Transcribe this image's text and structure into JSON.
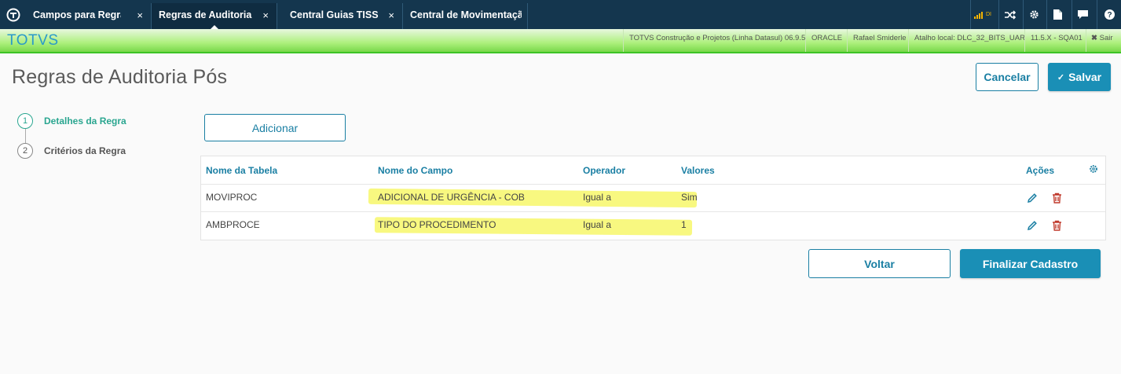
{
  "tabs": [
    {
      "label": "Campos para Regras de",
      "close": "×"
    },
    {
      "label": "Regras de Auditoria e",
      "close": "×"
    },
    {
      "label": "Central Guias TISS",
      "close": "×"
    },
    {
      "label": "Central de Movimentação",
      "close": ""
    }
  ],
  "topbar_icons": [
    "signal-icon",
    "shuffle-icon",
    "gear-icon",
    "document-icon",
    "chat-icon",
    "help-icon"
  ],
  "topbar_signal_text": "DI",
  "brand": "TOTVS",
  "info": {
    "company": "TOTVS Construção e Projetos (Linha Datasul) 06.9.5...",
    "db": "ORACLE",
    "user": "Rafael Smiderle",
    "shortcut": "Atalho local: DLC_32_BITS_UAR",
    "version": "11.5.X - SQA01",
    "exit": "Sair"
  },
  "page": {
    "title": "Regras de Auditoria Pós"
  },
  "buttons": {
    "cancel": "Cancelar",
    "save": "Salvar",
    "add": "Adicionar",
    "back": "Voltar",
    "finish": "Finalizar Cadastro"
  },
  "steps": [
    {
      "num": "1",
      "label": "Detalhes da Regra"
    },
    {
      "num": "2",
      "label": "Critérios da Regra"
    }
  ],
  "table": {
    "headers": {
      "table": "Nome da Tabela",
      "field": "Nome do Campo",
      "operator": "Operador",
      "values": "Valores",
      "actions": "Ações"
    },
    "rows": [
      {
        "table": "MOVIPROC",
        "field": "ADICIONAL DE URGÊNCIA - COB",
        "operator": "Igual a",
        "value": "Sim"
      },
      {
        "table": "AMBPROCE",
        "field": "TIPO DO PROCEDIMENTO",
        "operator": "Igual a",
        "value": "1"
      }
    ]
  },
  "colors": {
    "accent": "#1a8fb6",
    "topbar": "#14364e",
    "step_active": "#2aa690",
    "delete": "#c0392b",
    "highlight": "#f7f76a"
  }
}
